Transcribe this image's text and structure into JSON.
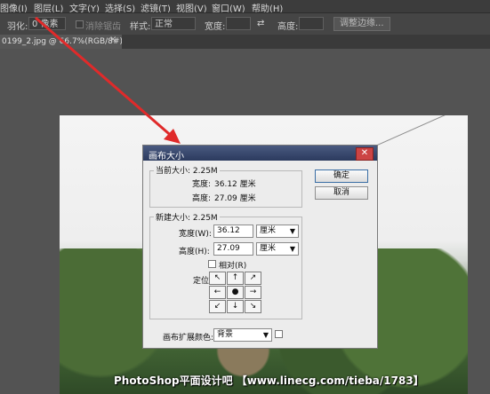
{
  "menubar": {
    "items": [
      "图像(I)",
      "图层(L)",
      "文字(Y)",
      "选择(S)",
      "滤镜(T)",
      "视图(V)",
      "窗口(W)",
      "帮助(H)"
    ]
  },
  "options": {
    "feather_label": "羽化:",
    "feather_value": "0 像素",
    "antialias_label": "消除锯齿",
    "style_label": "样式:",
    "style_value": "正常",
    "width_label": "宽度:",
    "height_label": "高度:",
    "refine_button": "调整边缘..."
  },
  "document_tab": {
    "title": "0199_2.jpg @ 66.7%(RGB/8#) *",
    "close": "×"
  },
  "watermark": "PhotoShop平面设计吧 【www.linecg.com/tieba/1783】",
  "dialog": {
    "title": "画布大小",
    "close_icon": "✕",
    "current": {
      "label": "当前大小: 2.25M",
      "width_label": "宽度:",
      "width_value": "36.12 厘米",
      "height_label": "高度:",
      "height_value": "27.09 厘米"
    },
    "new": {
      "label": "新建大小: 2.25M",
      "width_label": "宽度(W):",
      "width_value": "36.12",
      "width_unit": "厘米",
      "height_label": "高度(H):",
      "height_value": "27.09",
      "height_unit": "厘米",
      "relative_label": "相对(R)",
      "anchor_label": "定位:"
    },
    "ext_color_label": "画布扩展颜色:",
    "ext_color_value": "背景",
    "ok_button": "确定",
    "cancel_button": "取消"
  },
  "anchor_arrows": [
    "↖",
    "↑",
    "↗",
    "←",
    "●",
    "→",
    "↙",
    "↓",
    "↘"
  ]
}
